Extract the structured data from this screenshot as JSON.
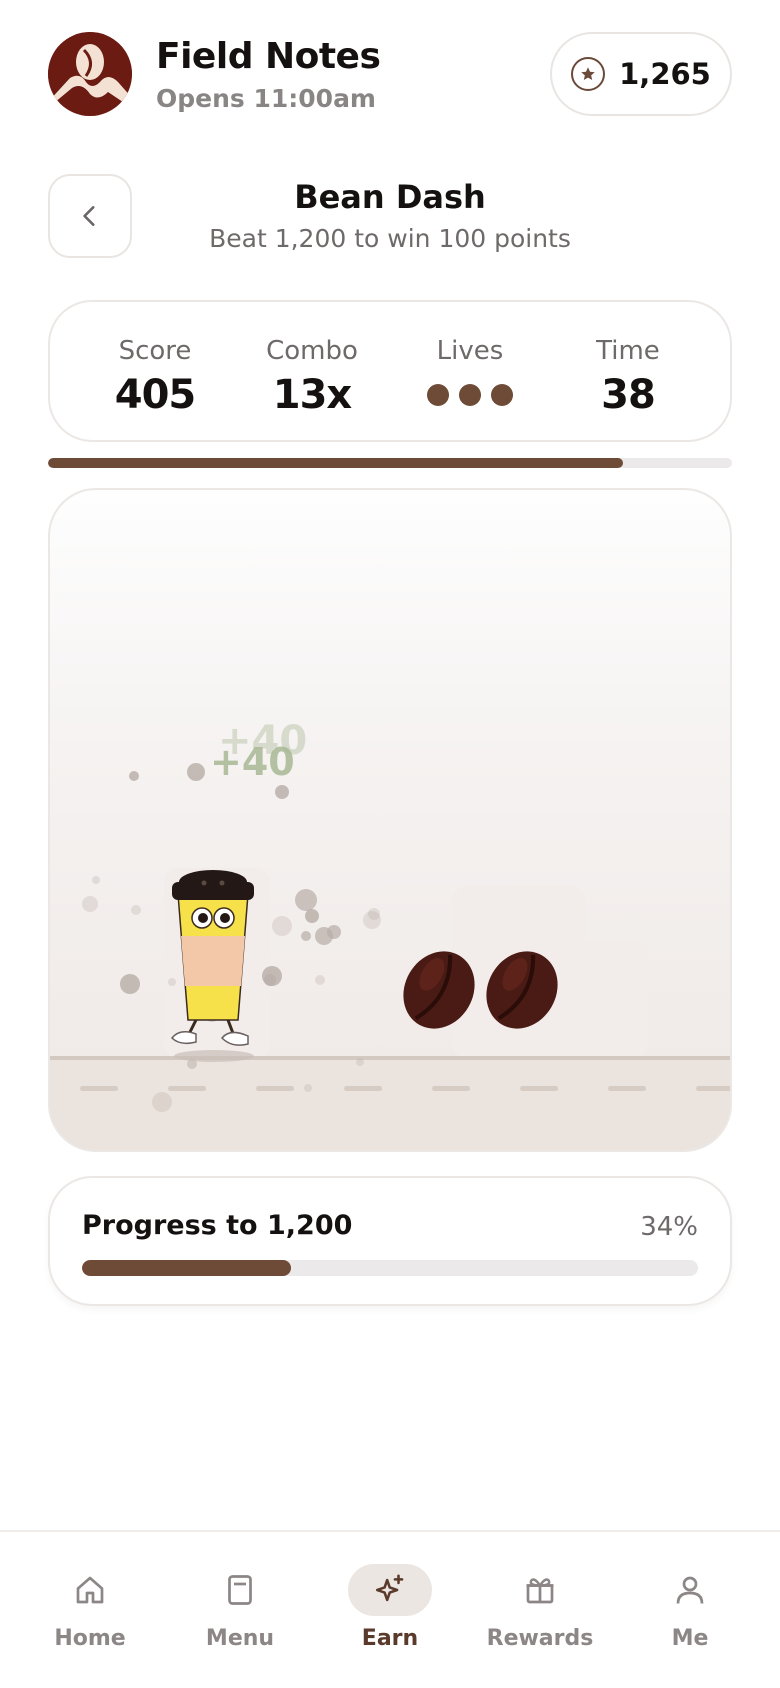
{
  "store": {
    "name": "Field Notes",
    "hours": "Opens 11:00am"
  },
  "points": {
    "value": "1,265"
  },
  "game": {
    "title": "Bean Dash",
    "subtitle": "Beat 1,200 to win 100 points"
  },
  "stats": {
    "score_label": "Score",
    "score": "405",
    "combo_label": "Combo",
    "combo": "13x",
    "lives_label": "Lives",
    "lives": 3,
    "time_label": "Time",
    "time": "38"
  },
  "time_remaining_fraction": 0.84,
  "floating_scores": [
    "+40",
    "+40"
  ],
  "progress": {
    "label": "Progress to 1,200",
    "percent": "34%",
    "fraction": 0.34
  },
  "nav": [
    {
      "label": "Home",
      "icon": "home-icon",
      "active": false
    },
    {
      "label": "Menu",
      "icon": "menu-book-icon",
      "active": false
    },
    {
      "label": "Earn",
      "icon": "sparkle-icon",
      "active": true
    },
    {
      "label": "Rewards",
      "icon": "gift-icon",
      "active": false
    },
    {
      "label": "Me",
      "icon": "person-icon",
      "active": false
    }
  ],
  "colors": {
    "accent": "#6e4b37",
    "logo": "#6b1b12",
    "track": "#ebe9ea"
  }
}
